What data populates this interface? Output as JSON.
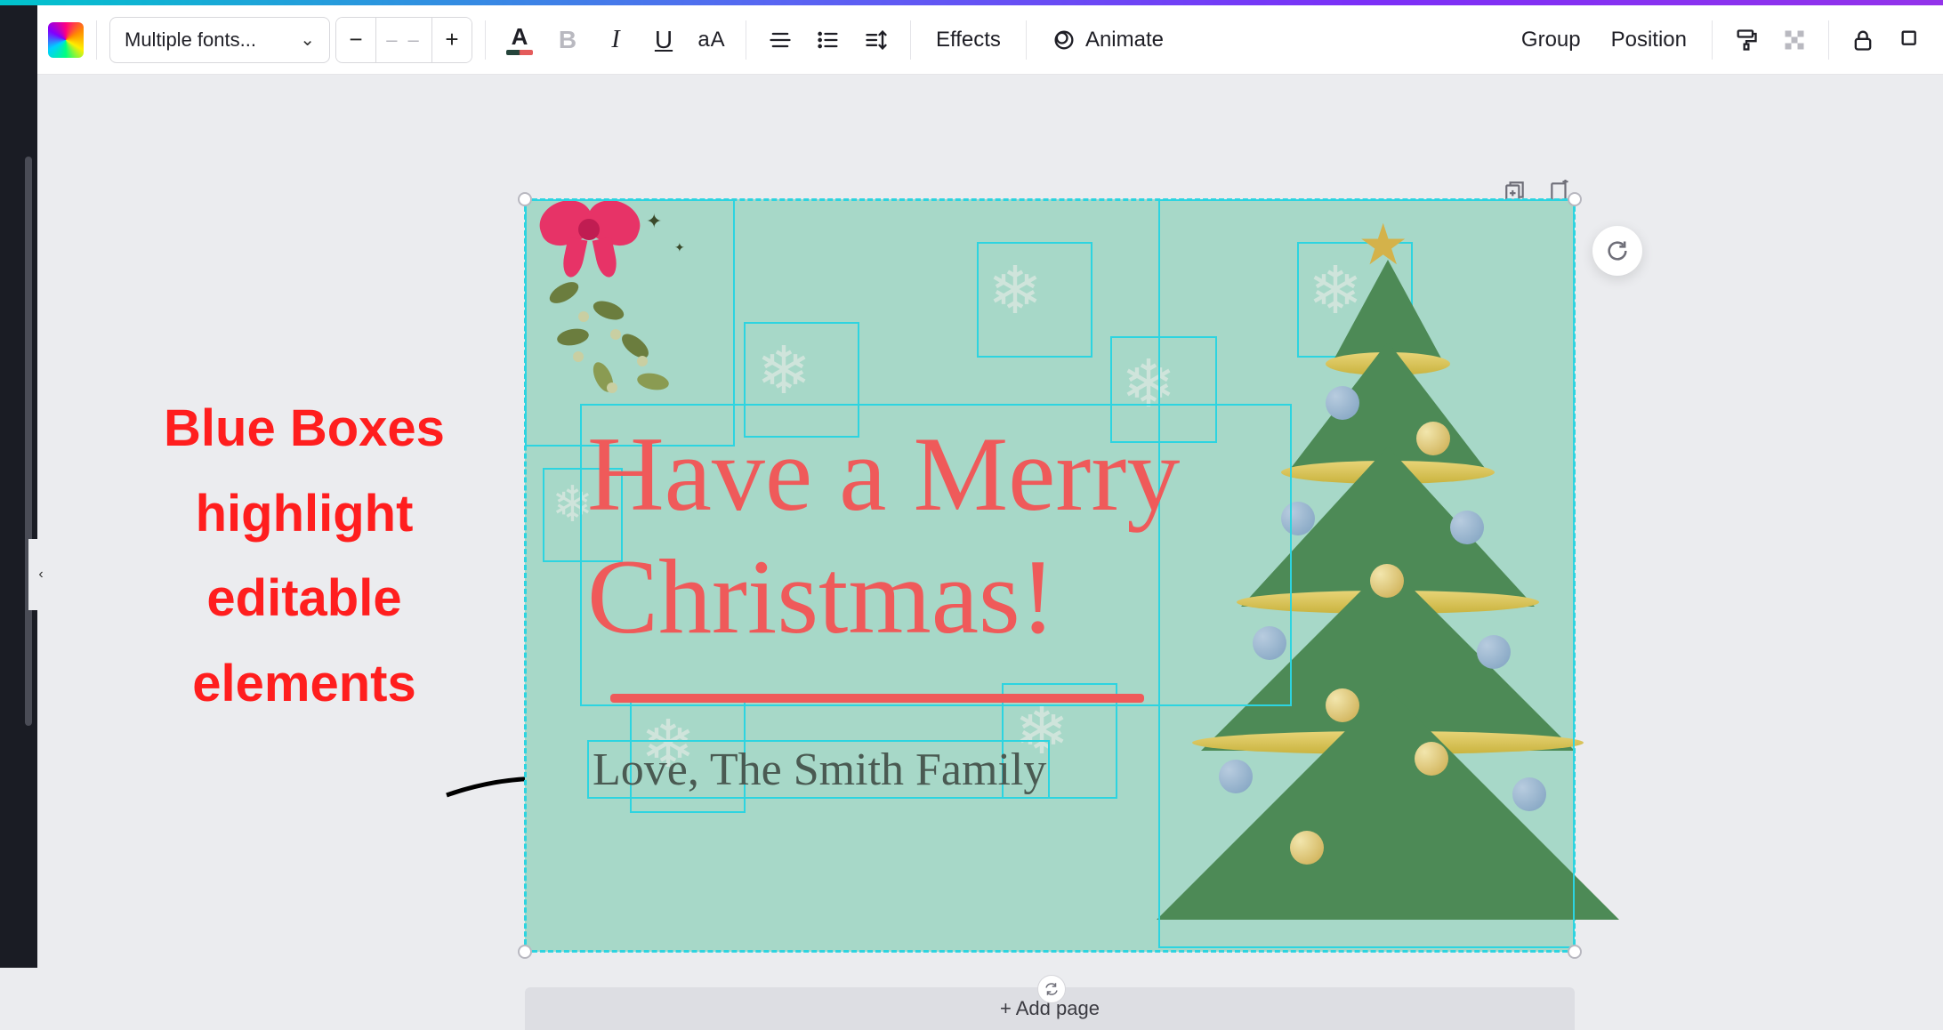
{
  "toolbar": {
    "font_label": "Multiple fonts...",
    "font_size_placeholder": "– –",
    "effects_label": "Effects",
    "animate_label": "Animate",
    "group_label": "Group",
    "position_label": "Position"
  },
  "annotation": {
    "line1": "Blue Boxes",
    "line2": "highlight",
    "line3": "editable",
    "line4": "elements"
  },
  "card": {
    "headline": "Have a Merry Christmas!",
    "subtext": "Love, The Smith Family"
  },
  "canvas": {
    "add_page_label": "+ Add page"
  }
}
